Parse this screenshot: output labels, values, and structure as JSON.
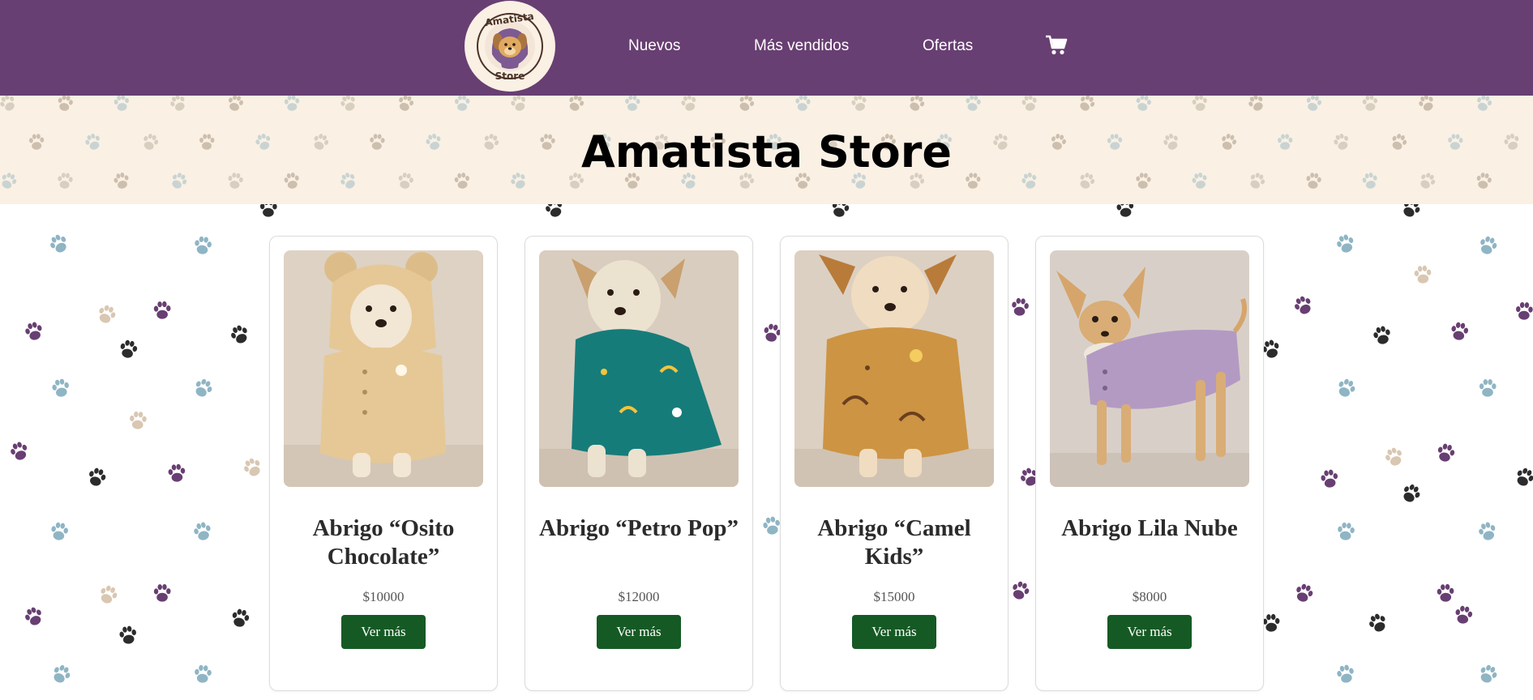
{
  "header": {
    "logo_text_top": "Amatista",
    "logo_text_bottom": "Store",
    "nav": [
      {
        "label": "Nuevos"
      },
      {
        "label": "Más vendidos"
      },
      {
        "label": "Ofertas"
      }
    ],
    "cart_icon": "shopping-cart-icon",
    "background_color": "#683f72"
  },
  "hero": {
    "title": "Amatista Store",
    "background_color": "#faf0e4"
  },
  "products": [
    {
      "title": "Abrigo “Osito Chocolate”",
      "price": "$10000",
      "button": "Ver más",
      "coat_color": "#e6c896"
    },
    {
      "title": "Abrigo “Petro Pop”",
      "price": "$12000",
      "button": "Ver más",
      "coat_color": "#167c7a"
    },
    {
      "title": "Abrigo “Camel Kids”",
      "price": "$15000",
      "button": "Ver más",
      "coat_color": "#cd9443"
    },
    {
      "title": "Abrigo Lila Nube",
      "price": "$8000",
      "button": "Ver más",
      "coat_color": "#b39ac3"
    }
  ],
  "colors": {
    "button": "#155a24",
    "paw_palette": [
      "#683f72",
      "#2c2c2c",
      "#8fb5c4",
      "#d9c7b2"
    ]
  }
}
